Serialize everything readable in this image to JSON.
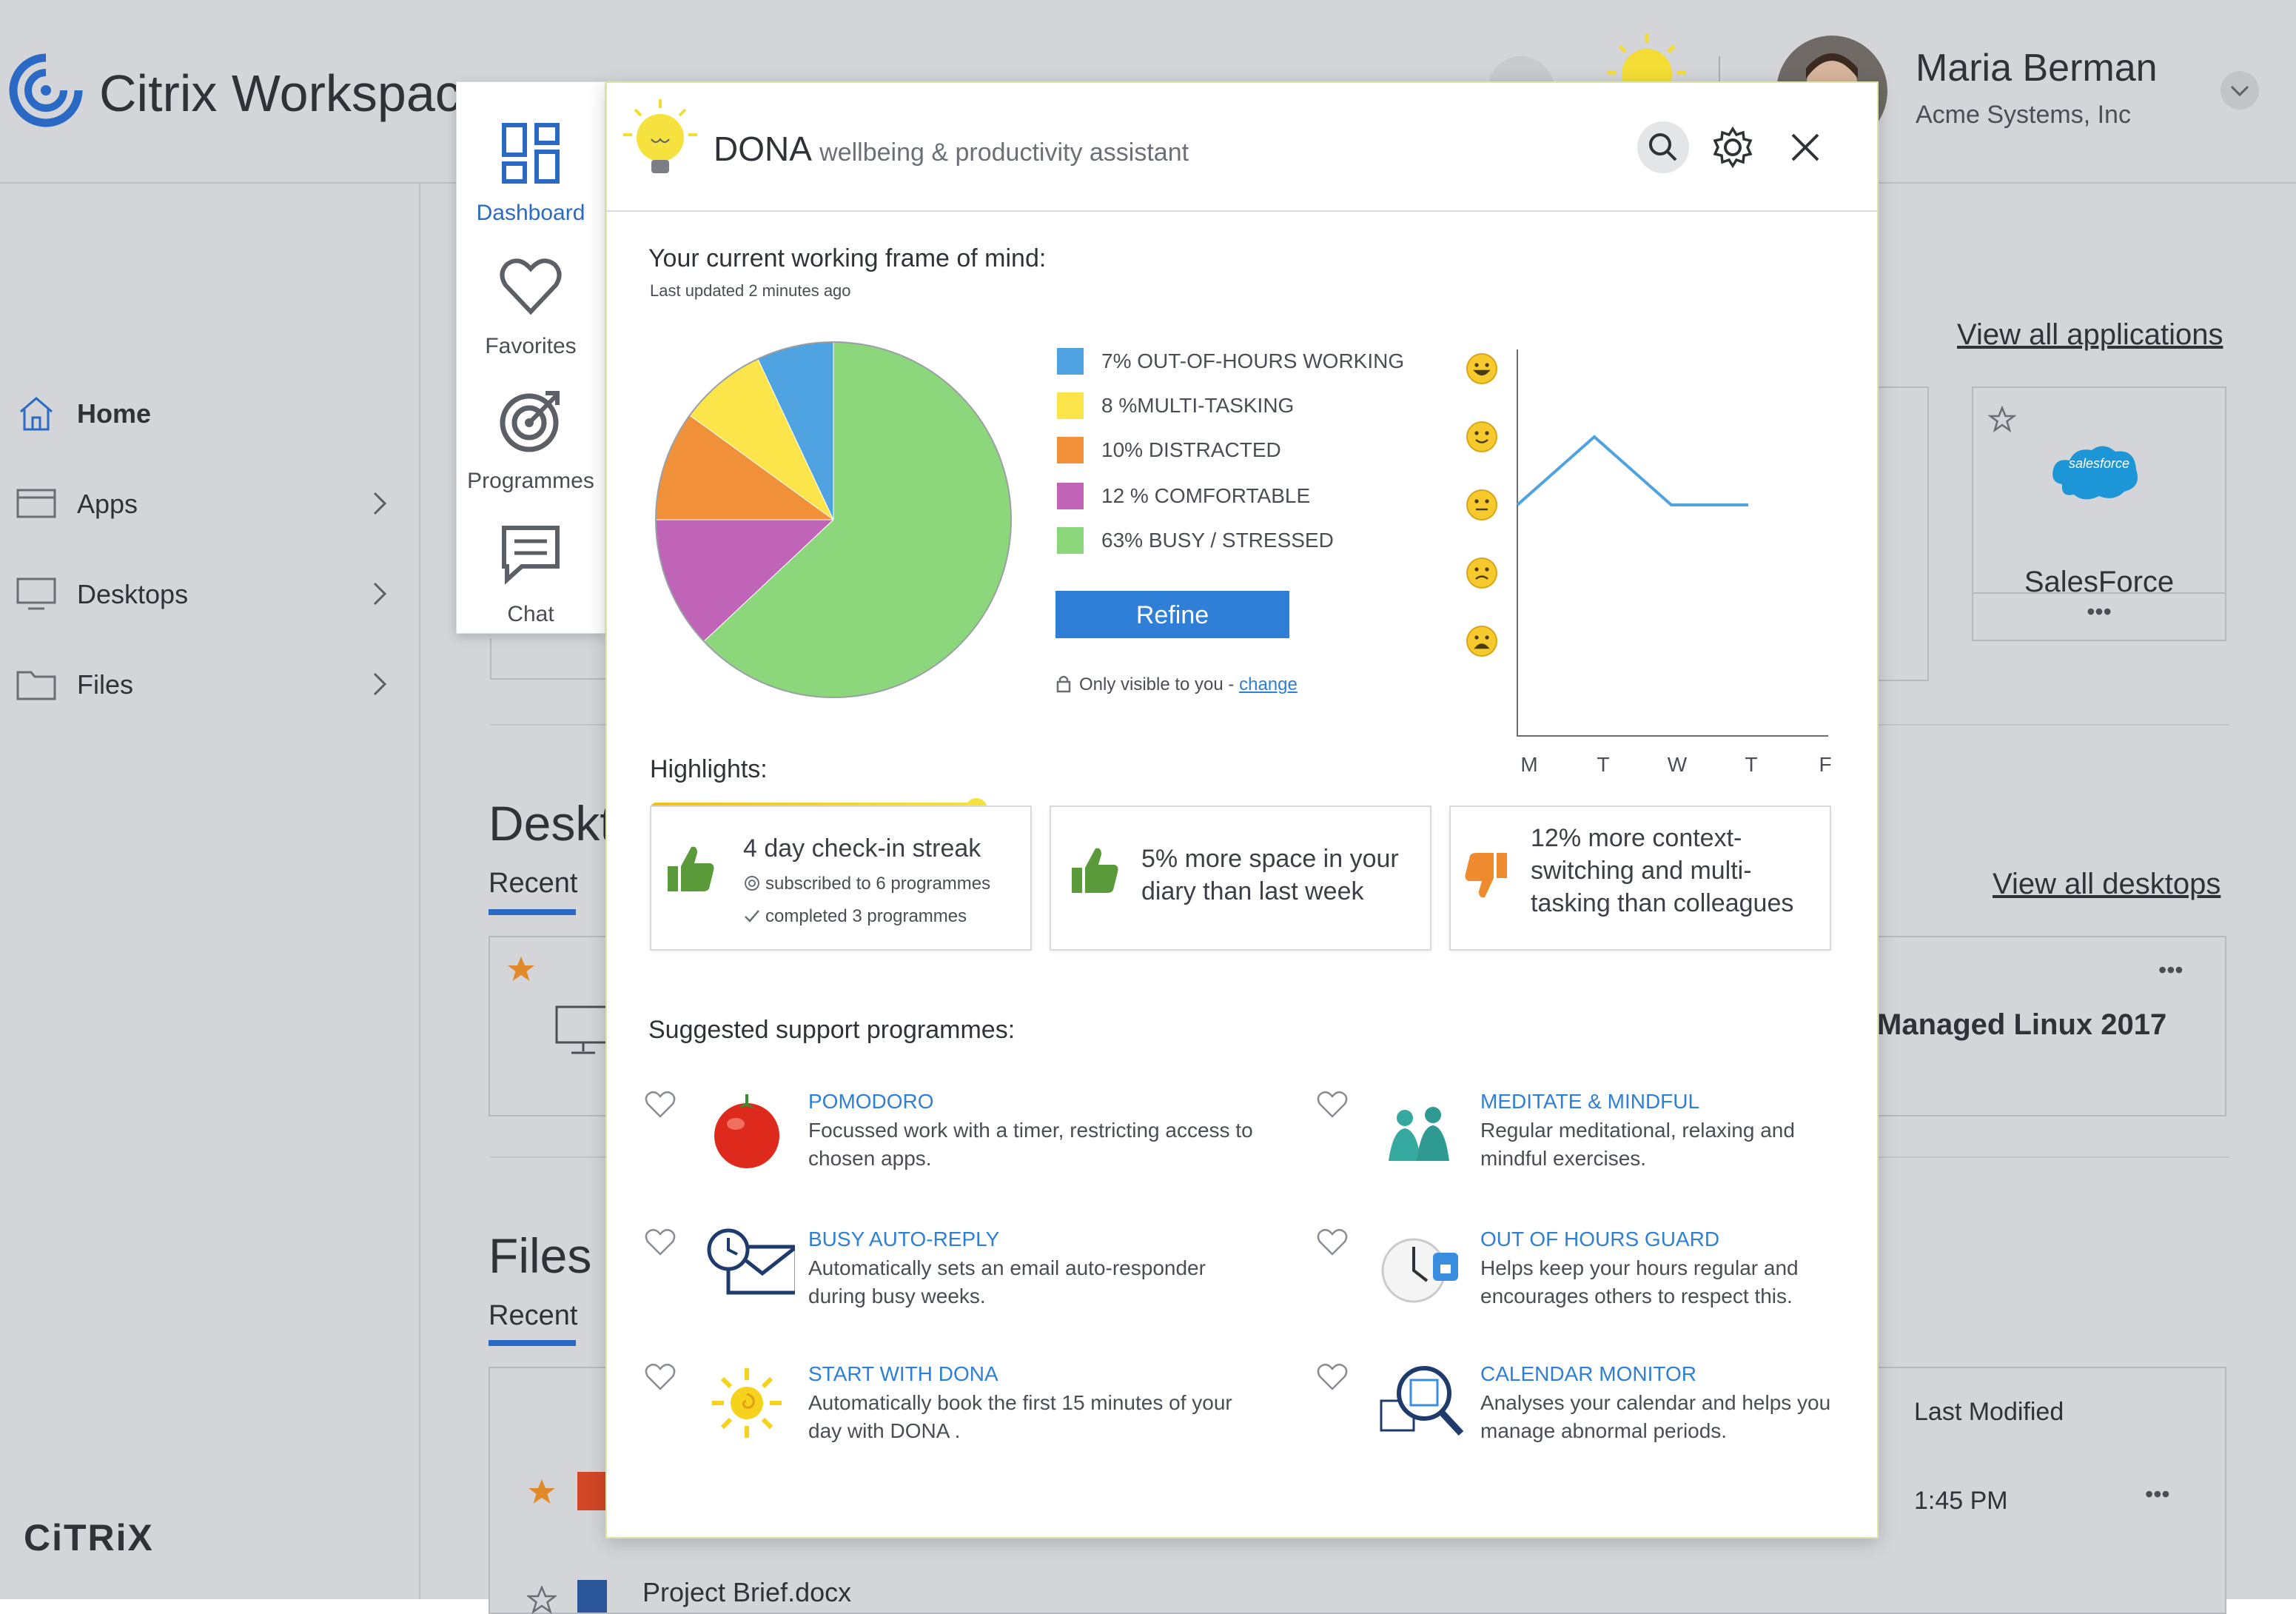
{
  "app": {
    "title": "Citrix Workspace",
    "footer_brand": "CiTRiX"
  },
  "user": {
    "name": "Maria Berman",
    "org": "Acme Systems, Inc"
  },
  "sidebar": {
    "items": [
      {
        "label": "Home",
        "icon": "home-icon"
      },
      {
        "label": "Apps",
        "icon": "apps-icon"
      },
      {
        "label": "Desktops",
        "icon": "desktop-icon"
      },
      {
        "label": "Files",
        "icon": "folder-icon"
      }
    ]
  },
  "background": {
    "view_all_apps": "View all applications",
    "view_all_desktops": "View all desktops",
    "salesforce_label": "SalesForce",
    "salesforce_logo_text": "salesforce",
    "desktops_heading": "Desktops",
    "desktops_recent": "Recent",
    "linux_label": "Managed Linux 2017",
    "files_heading": "Files",
    "files_recent": "Recent",
    "last_modified": "Last Modified",
    "time": "1:45 PM",
    "file_name": "Project Brief.docx",
    "more": "•••"
  },
  "panel": {
    "items": [
      {
        "label": "Dashboard",
        "icon": "dashboard-icon",
        "active": true
      },
      {
        "label": "Favorites",
        "icon": "heart-icon"
      },
      {
        "label": "Programmes",
        "icon": "target-icon"
      },
      {
        "label": "Chat",
        "icon": "chat-icon"
      }
    ]
  },
  "dialog": {
    "brand": "DONA",
    "subtitle": "wellbeing & productivity assistant",
    "frame_title": "Your current working frame of mind:",
    "last_updated": "Last updated 2 minutes ago",
    "refine_label": "Refine",
    "privacy_text": "Only visible to you - ",
    "privacy_link": "change",
    "highlights_title": "Highlights:",
    "highlights": [
      {
        "text": "4 day check-in streak",
        "sub1": "subscribed to 6 programmes",
        "sub2": "completed 3 programmes",
        "kind": "positive"
      },
      {
        "text": "5% more space in your diary than last week",
        "kind": "positive"
      },
      {
        "text": "12% more context-switching and multi-tasking than colleagues",
        "kind": "negative"
      }
    ],
    "programmes_title": "Suggested support programmes:",
    "programmes": [
      {
        "title": "POMODORO",
        "desc": "Focussed work with a timer, restricting access to chosen apps.",
        "icon": "tomato-icon"
      },
      {
        "title": "MEDITATE  & MINDFUL",
        "desc": "Regular meditational, relaxing and mindful exercises.",
        "icon": "meditation-icon"
      },
      {
        "title": "BUSY AUTO-REPLY",
        "desc": "Automatically sets an email auto-responder during busy weeks.",
        "icon": "clock-mail-icon"
      },
      {
        "title": "OUT OF HOURS GUARD",
        "desc": "Helps keep your hours regular and encourages others to respect this.",
        "icon": "clock-lock-icon"
      },
      {
        "title": "START WITH DONA",
        "desc": "Automatically book the first 15 minutes of your day with DONA .",
        "icon": "sun-icon"
      },
      {
        "title": "CALENDAR MONITOR",
        "desc": "Analyses your calendar and helps you manage abnormal periods.",
        "icon": "calendar-search-icon"
      }
    ]
  },
  "chart_data": [
    {
      "type": "pie",
      "slices": [
        {
          "label": "7% OUT-OF-HOURS WORKING",
          "value": 7,
          "color": "#4fa3e0"
        },
        {
          "label": "8 %MULTI-TASKING",
          "value": 8,
          "color": "#fbe54a"
        },
        {
          "label": "10% DISTRACTED",
          "value": 10,
          "color": "#f0913a"
        },
        {
          "label": "12 % COMFORTABLE",
          "value": 12,
          "color": "#c064b8"
        },
        {
          "label": "63% BUSY / STRESSED",
          "value": 63,
          "color": "#8cd67c"
        }
      ]
    },
    {
      "type": "line",
      "x": [
        "M",
        "T",
        "W",
        "T",
        "F"
      ],
      "y_levels": 5,
      "series": [
        {
          "values": [
            3,
            4,
            3,
            3,
            null
          ],
          "color": "#4fa3e0"
        }
      ],
      "ylim": [
        1,
        5
      ],
      "y_icons": [
        "very-happy-face-icon",
        "happy-face-icon",
        "neutral-face-icon",
        "sad-face-icon",
        "very-sad-face-icon"
      ]
    }
  ],
  "colors": {
    "accent": "#2f7fd6",
    "positive": "#5a9a3a",
    "negative": "#ef8a2e",
    "streak": "#f6d21c"
  }
}
